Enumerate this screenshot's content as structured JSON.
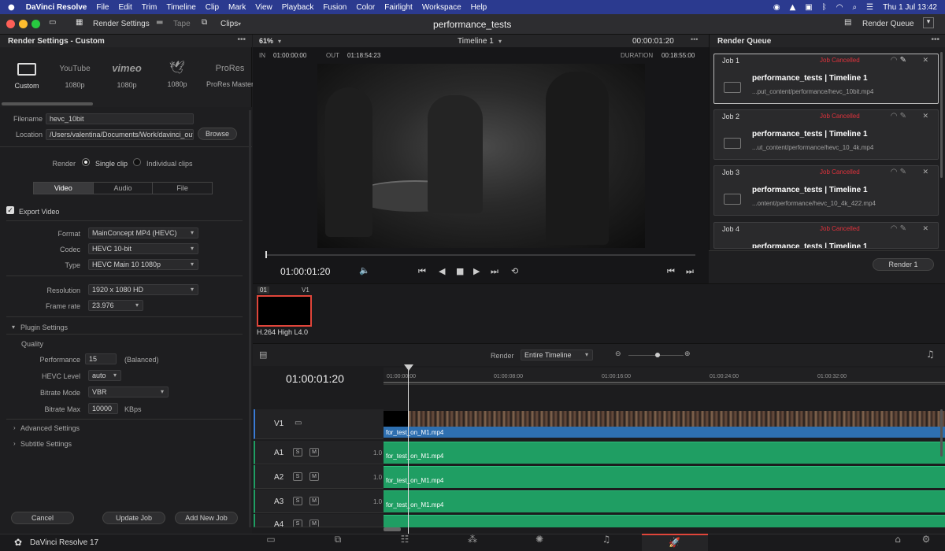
{
  "menubar": {
    "app": "DaVinci Resolve",
    "items": [
      "File",
      "Edit",
      "Trim",
      "Timeline",
      "Clip",
      "Mark",
      "View",
      "Playback",
      "Fusion",
      "Color",
      "Fairlight",
      "Workspace",
      "Help"
    ],
    "clock": "Thu 1 Jul  13:42"
  },
  "toolbar": {
    "render_settings": "Render Settings",
    "tape": "Tape",
    "clips": "Clips",
    "project_title": "performance_tests",
    "render_queue": "Render Queue"
  },
  "render_settings": {
    "title": "Render Settings - Custom",
    "presets": [
      {
        "label": "Custom",
        "logo": ""
      },
      {
        "label": "1080p",
        "logo": "YouTube"
      },
      {
        "label": "1080p",
        "logo": "vimeo"
      },
      {
        "label": "1080p",
        "logo": "twitter-bird"
      },
      {
        "label": "ProRes Master",
        "logo": "ProRes"
      }
    ],
    "filename_label": "Filename",
    "filename": "hevc_10bit",
    "location_label": "Location",
    "location": "/Users/valentina/Documents/Work/davinci_out",
    "browse": "Browse",
    "render_label": "Render",
    "single_clip": "Single clip",
    "individual_clips": "Individual clips",
    "tabs": [
      "Video",
      "Audio",
      "File"
    ],
    "export_video": "Export Video",
    "format_label": "Format",
    "format": "MainConcept MP4 (HEVC)",
    "codec_label": "Codec",
    "codec": "HEVC 10-bit",
    "type_label": "Type",
    "type": "HEVC Main 10 1080p",
    "resolution_label": "Resolution",
    "resolution": "1920 x 1080 HD",
    "framerate_label": "Frame rate",
    "framerate": "23.976",
    "plugin_settings": "Plugin Settings",
    "quality": "Quality",
    "performance_label": "Performance",
    "performance": "15",
    "performance_note": "(Balanced)",
    "hevc_level_label": "HEVC Level",
    "hevc_level": "auto",
    "bitrate_mode_label": "Bitrate Mode",
    "bitrate_mode": "VBR",
    "bitrate_max_label": "Bitrate Max",
    "bitrate_max": "10000",
    "bitrate_unit": "KBps",
    "advanced": "Advanced Settings",
    "subtitle": "Subtitle Settings",
    "cancel": "Cancel",
    "update_job": "Update Job",
    "add_job": "Add New Job"
  },
  "viewer": {
    "zoom": "61%",
    "timeline_name": "Timeline 1",
    "timecode_top": "00:00:01:20",
    "in_label": "IN",
    "in": "01:00:00:00",
    "out_label": "OUT",
    "out": "01:18:54:23",
    "duration_label": "DURATION",
    "duration": "00:18:55:00",
    "current_tc": "01:00:01:20"
  },
  "clip_strip": {
    "index": "01",
    "track": "V1",
    "codec": "H.264 High L4.0"
  },
  "render_queue": {
    "title": "Render Queue",
    "jobs": [
      {
        "id": "Job 1",
        "status": "Job Cancelled",
        "name": "performance_tests | Timeline 1",
        "path": "...put_content/performance/hevc_10bit.mp4"
      },
      {
        "id": "Job 2",
        "status": "Job Cancelled",
        "name": "performance_tests | Timeline 1",
        "path": "...ut_content/performance/hevc_10_4k.mp4"
      },
      {
        "id": "Job 3",
        "status": "Job Cancelled",
        "name": "performance_tests | Timeline 1",
        "path": "...ontent/performance/hevc_10_4k_422.mp4"
      },
      {
        "id": "Job 4",
        "status": "Job Cancelled",
        "name": "performance_tests | Timeline 1",
        "path": ""
      }
    ],
    "render_button": "Render 1"
  },
  "timeline": {
    "render_label": "Render",
    "render_range": "Entire Timeline",
    "timecode": "01:00:01:20",
    "ruler": [
      "01:00:00:00",
      "01:00:08:00",
      "01:00:16:00",
      "01:00:24:00",
      "01:00:32:00"
    ],
    "tracks": [
      {
        "name": "V1",
        "clip": "for_test_on_M1.mp4"
      },
      {
        "name": "A1",
        "level": "1.0",
        "clip": "for_test_on_M1.mp4"
      },
      {
        "name": "A2",
        "level": "1.0",
        "clip": "for_test_on_M1.mp4"
      },
      {
        "name": "A3",
        "level": "1.0",
        "clip": "for_test_on_M1.mp4"
      },
      {
        "name": "A4",
        "level": "",
        "clip": ""
      }
    ],
    "solo": "S",
    "mute": "M"
  },
  "footer": {
    "app_version": "DaVinci Resolve 17",
    "pages": [
      "media",
      "cut",
      "edit",
      "fusion",
      "color",
      "fairlight",
      "deliver"
    ]
  }
}
